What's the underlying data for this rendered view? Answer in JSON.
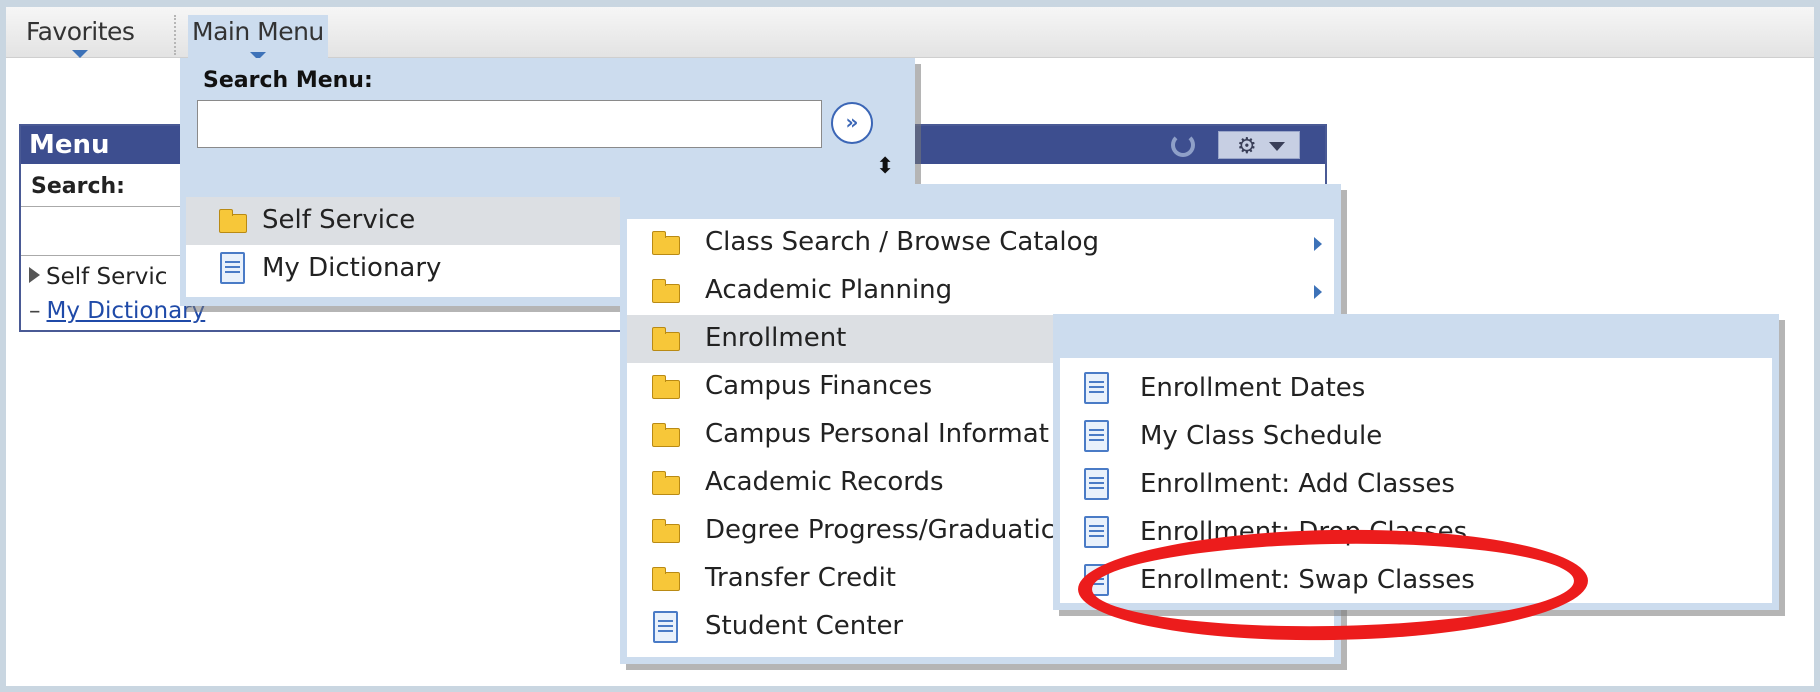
{
  "navbar": {
    "favorites": "Favorites",
    "main_menu": "Main Menu"
  },
  "pagelet": {
    "title": "Menu",
    "search_label": "Search:",
    "tree_item": "Self Servic",
    "link": "My Dictionary",
    "refresh_icon": "refresh-icon",
    "gear_icon": "gear-icon"
  },
  "main_menu": {
    "search_label": "Search Menu:",
    "search_value": "",
    "go_icon": "»",
    "sort_icon": "⬍",
    "items": [
      {
        "label": "Self Service",
        "icon": "folder-icon",
        "selected": true
      },
      {
        "label": "My Dictionary",
        "icon": "document-icon",
        "selected": false
      }
    ]
  },
  "self_service_menu": {
    "items": [
      {
        "label": "Class Search / Browse Catalog",
        "icon": "folder-icon",
        "has_submenu": true
      },
      {
        "label": "Academic Planning",
        "icon": "folder-icon",
        "has_submenu": true
      },
      {
        "label": "Enrollment",
        "icon": "folder-icon",
        "selected": true
      },
      {
        "label": "Campus Finances",
        "icon": "folder-icon"
      },
      {
        "label": "Campus Personal Informat",
        "icon": "folder-icon"
      },
      {
        "label": "Academic Records",
        "icon": "folder-icon"
      },
      {
        "label": "Degree Progress/Graduatic",
        "icon": "folder-icon"
      },
      {
        "label": "Transfer Credit",
        "icon": "folder-icon"
      },
      {
        "label": "Student Center",
        "icon": "document-icon"
      }
    ]
  },
  "enrollment_menu": {
    "items": [
      {
        "label": "Enrollment Dates",
        "icon": "document-icon"
      },
      {
        "label": "My Class Schedule",
        "icon": "document-icon"
      },
      {
        "label": "Enrollment: Add Classes",
        "icon": "document-icon"
      },
      {
        "label": "Enrollment: Drop Classes",
        "icon": "document-icon"
      },
      {
        "label": "Enrollment: Swap Classes",
        "icon": "document-icon",
        "highlighted": true
      }
    ]
  },
  "colors": {
    "frame": "#c9d6e1",
    "menu_bg": "#ccdcee",
    "pagelet_header": "#3d4e8f",
    "annotation": "#ec1c1c"
  }
}
